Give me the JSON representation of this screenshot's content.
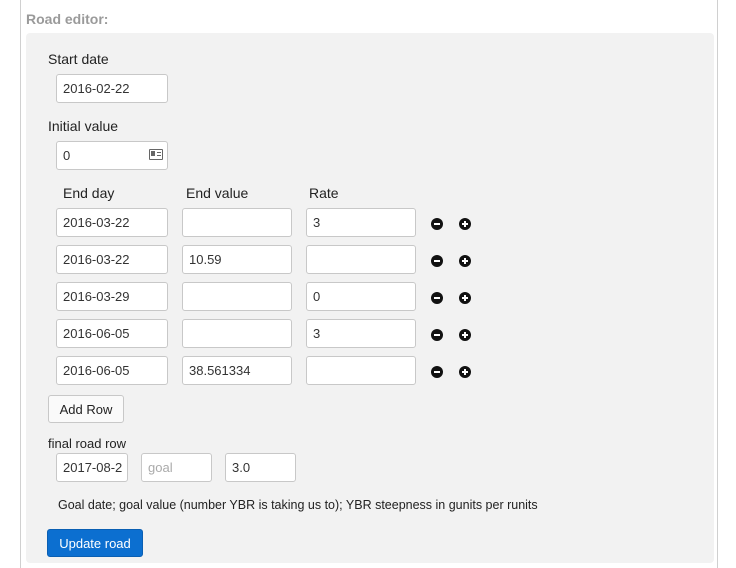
{
  "editor": {
    "title": "Road editor:",
    "start_date_label": "Start date",
    "start_date_value": "2016-02-22",
    "initial_value_label": "Initial value",
    "initial_value": "0",
    "columns": {
      "end_day": "End day",
      "end_value": "End value",
      "rate": "Rate"
    },
    "rows": [
      {
        "end_day": "2016-03-22",
        "end_value": "",
        "rate": "3"
      },
      {
        "end_day": "2016-03-22",
        "end_value": "10.59",
        "rate": ""
      },
      {
        "end_day": "2016-03-29",
        "end_value": "",
        "rate": "0"
      },
      {
        "end_day": "2016-06-05",
        "end_value": "",
        "rate": "3"
      },
      {
        "end_day": "2016-06-05",
        "end_value": "38.561334",
        "rate": ""
      }
    ],
    "add_row_label": "Add Row",
    "final_row_label": "final road row",
    "final_date_value": "2017-08-2",
    "goal_placeholder": "goal",
    "final_rate_value": "3.0",
    "help_text": "Goal date; goal value (number YBR is taking us to); YBR steepness in gunits per runits",
    "update_label": "Update road",
    "icons": {
      "remove": "minus-circle-icon",
      "add": "plus-circle-icon",
      "id_card": "id-card-icon"
    },
    "colors": {
      "primary": "#0c6fd0",
      "panel": "#f2f2f2"
    }
  }
}
